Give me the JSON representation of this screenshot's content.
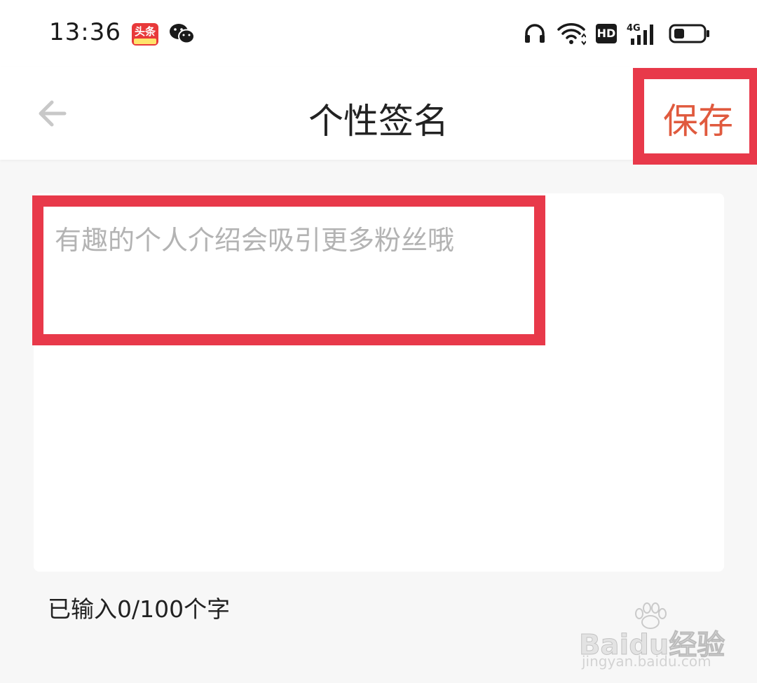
{
  "status_bar": {
    "time": "13:36",
    "app_badge_label": "头条",
    "network_label": "4G",
    "hd_label": "HD",
    "icons": [
      "toutiao-app-icon",
      "wechat-icon",
      "headset-icon",
      "wifi-icon",
      "hd-icon",
      "signal-4g-icon",
      "battery-icon"
    ]
  },
  "header": {
    "back_icon": "arrow-left-icon",
    "title": "个性签名",
    "save_label": "保存"
  },
  "signature": {
    "placeholder": "有趣的个人介绍会吸引更多粉丝哦",
    "value": "",
    "count_label": "已输入0/100个字"
  },
  "watermark": {
    "brand": "Baidu经验",
    "url": "jingyan.baidu.com"
  },
  "colors": {
    "accent": "#e05a3e",
    "highlight_outline": "#e8394a",
    "placeholder": "#b3b3b3",
    "background": "#f7f7f7"
  }
}
